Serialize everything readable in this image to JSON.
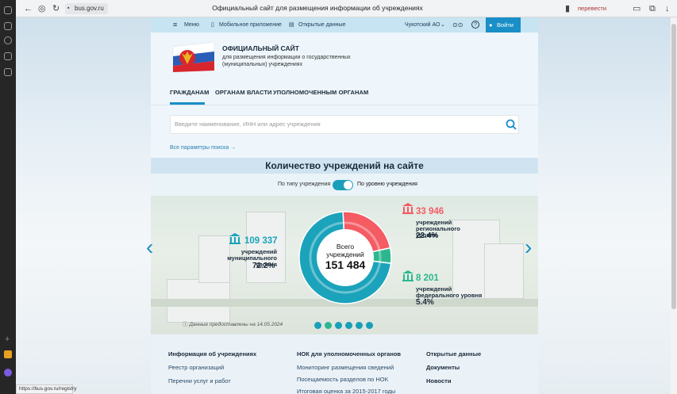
{
  "browser": {
    "url": "bus.gov.ru",
    "tab_title": "Официальный сайт для размещения информации об учреждениях",
    "translate": "перевести",
    "status_url": "https://bus.gov.ru/registry"
  },
  "topbar": {
    "menu": "Меню",
    "mobile": "Мобильное приложение",
    "open_data": "Открытые данные",
    "region": "Чукотский АО",
    "login": "Войти"
  },
  "header": {
    "title": "ОФИЦИАЛЬНЫЙ САЙТ",
    "description": "для размещения информации о государственных (муниципальных) учреждениях"
  },
  "tabs": [
    {
      "label": "ГРАЖДАНАМ",
      "active": true
    },
    {
      "label": "ОРГАНАМ ВЛАСТИ",
      "active": false
    },
    {
      "label": "УПОЛНОМОЧЕННЫМ ОРГАНАМ",
      "active": false
    }
  ],
  "search": {
    "placeholder": "Введите наименование, ИНН или адрес учреждения",
    "advanced": "Все параметры поиска →"
  },
  "stats": {
    "title": "Количество учреждений на сайте",
    "toggle_left": "По типу учреждения",
    "toggle_right": "По уровню учреждения",
    "total_label": "Всего учреждений",
    "total": "151 484",
    "date_note": "Данные предоставлены на 14.05.2024",
    "items": [
      {
        "value": "109 337",
        "label": "учреждений муниципального уровня",
        "pct": "72.2%",
        "share": 72.2,
        "color": "#1ba3bb"
      },
      {
        "value": "33 946",
        "label": "учреждений регионального уровня",
        "pct": "22.4%",
        "share": 22.4,
        "color": "#f45b63"
      },
      {
        "value": "8 201",
        "label": "учреждений федерального уровня",
        "pct": "5.4%",
        "share": 5.4,
        "color": "#2cb78f"
      }
    ]
  },
  "footer": {
    "col1": {
      "heading": "Информация об учреждениях",
      "links": [
        "Реестр организаций",
        "Перечни услуг и работ"
      ]
    },
    "col2": {
      "heading": "НОК для уполномоченных органов",
      "links": [
        "Мониторинг размещения сведений",
        "Посещаемость разделов по НОК",
        "Итоговая оценка за 2015-2017 годы"
      ]
    },
    "col3": {
      "heading": "Открытые данные",
      "links": [
        "Документы",
        "Новости"
      ]
    }
  },
  "colors": {
    "accent": "#1a8ec6",
    "municipal": "#1ba3bb",
    "regional": "#f45b63",
    "federal": "#2cb78f"
  }
}
